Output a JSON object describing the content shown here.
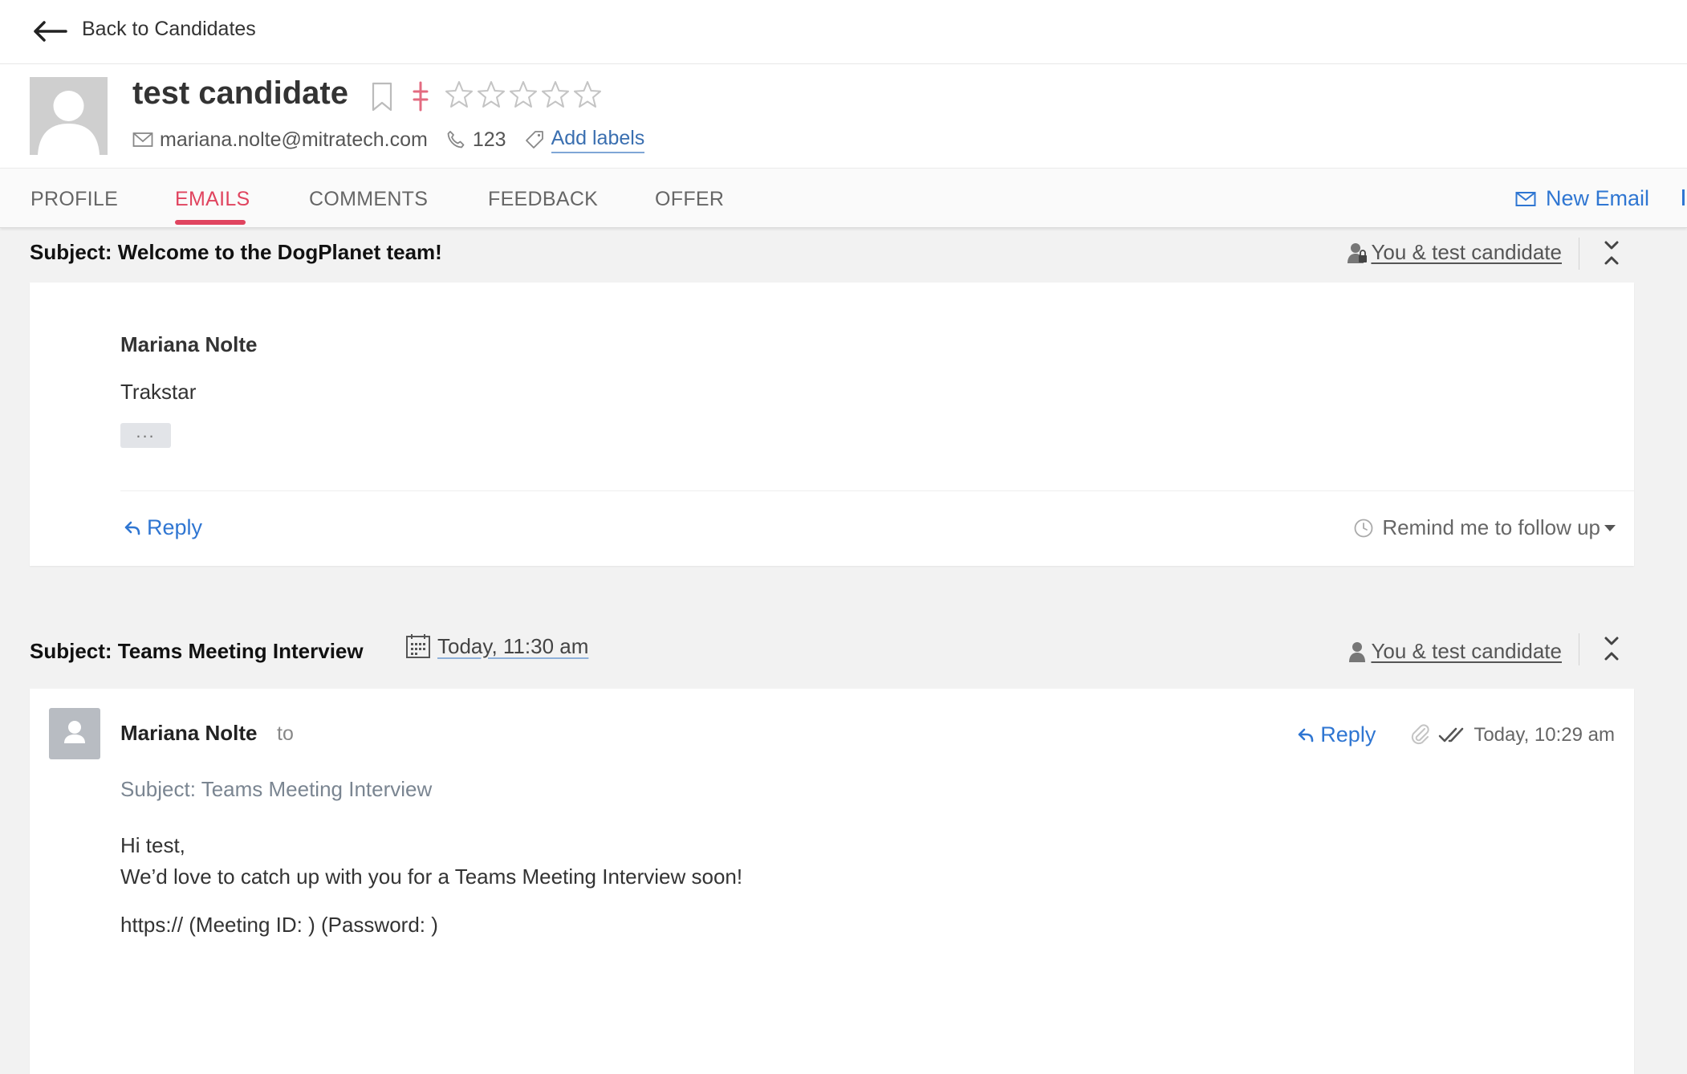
{
  "nav": {
    "back_label": "Back to Candidates"
  },
  "candidate": {
    "name": "test candidate",
    "email": "mariana.nolte@mitratech.com",
    "phone": "123",
    "add_labels": "Add labels",
    "rating": 0,
    "rating_max": 5
  },
  "tabs": [
    {
      "label": "PROFILE",
      "active": false
    },
    {
      "label": "EMAILS",
      "active": true
    },
    {
      "label": "COMMENTS",
      "active": false
    },
    {
      "label": "FEEDBACK",
      "active": false
    },
    {
      "label": "OFFER",
      "active": false
    }
  ],
  "actions": {
    "new_email": "New Email"
  },
  "threads": [
    {
      "subject": "Subject: Welcome to the DogPlanet team!",
      "participants": "You & test candidate",
      "sender": "Mariana Nolte",
      "body": "Trakstar",
      "ellipsis": "...",
      "reply": "Reply",
      "remind": "Remind me to follow up"
    },
    {
      "subject": "Subject: Teams Meeting Interview",
      "scheduled": "Today, 11:30 am",
      "participants": "You & test candidate",
      "sender": "Mariana Nolte",
      "to_label": "to",
      "reply": "Reply",
      "sent_time": "Today, 10:29 am",
      "subject_line": "Subject: Teams Meeting Interview",
      "body_line1": "Hi test,",
      "body_line2": "We’d love to catch up with you for a Teams Meeting Interview soon!",
      "body_line3": "https:// (Meeting ID: ) (Password: )"
    }
  ],
  "colors": {
    "accent_pink": "#e0445f",
    "link_blue": "#2f76d2",
    "page_bg": "#f2f2f2"
  }
}
